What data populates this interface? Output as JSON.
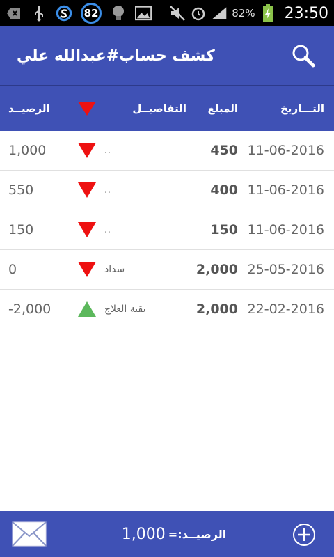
{
  "status_bar": {
    "badge": "82",
    "battery_percent": "82%",
    "time": "23:50",
    "icons": [
      "back-icon",
      "usb-icon",
      "sync-icon",
      "badge-icon",
      "lightbulb-icon",
      "image-icon",
      "mute-icon",
      "alarm-icon",
      "signal-icon",
      "battery-charging-icon"
    ]
  },
  "app_bar": {
    "title": "كشف حساب#عبدالله علي",
    "search_icon": "search-icon"
  },
  "table": {
    "headers": {
      "date": "التـــاريخ",
      "amount": "المبلغ",
      "details": "التفاصيــل",
      "balance": "الرصيــد"
    },
    "rows": [
      {
        "date": "11-06-2016",
        "amount": "450",
        "details": "..",
        "balance": "1,000",
        "direction": "down"
      },
      {
        "date": "11-06-2016",
        "amount": "400",
        "details": "..",
        "balance": "550",
        "direction": "down"
      },
      {
        "date": "11-06-2016",
        "amount": "150",
        "details": "..",
        "balance": "150",
        "direction": "down"
      },
      {
        "date": "25-05-2016",
        "amount": "2,000",
        "details": "سداد",
        "balance": "0",
        "direction": "down"
      },
      {
        "date": "22-02-2016",
        "amount": "2,000",
        "details": "بقية العلاج",
        "balance": "-2,000",
        "direction": "up"
      }
    ]
  },
  "bottom_bar": {
    "total_label": "الرصيــد:=",
    "total_value": "1,000",
    "mail_icon": "mail-icon",
    "add_icon": "add-circle-icon"
  },
  "colors": {
    "primary": "#3f51b5",
    "down_arrow": "#ee1111",
    "up_arrow": "#5cb85c"
  }
}
